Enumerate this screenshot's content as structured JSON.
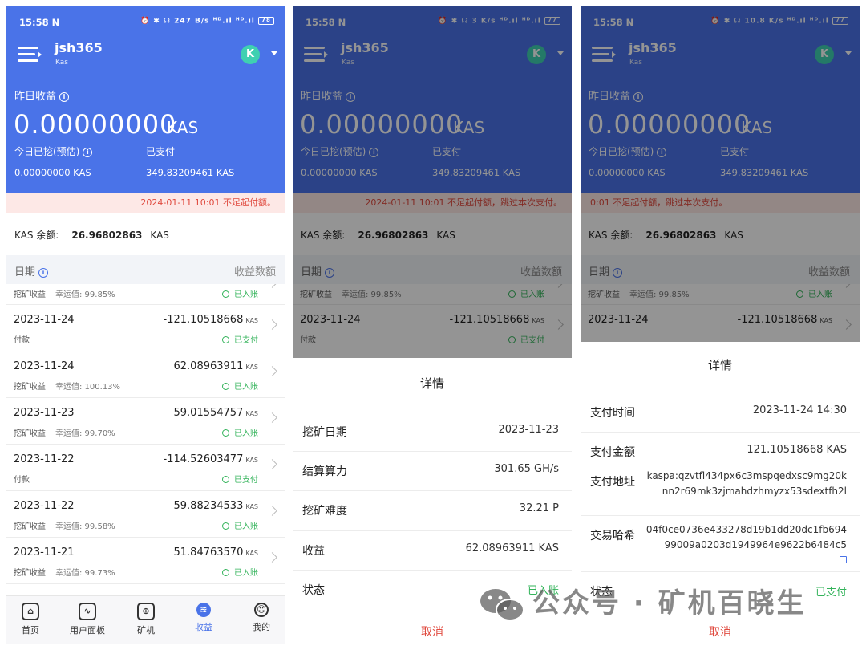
{
  "status": {
    "time": "15:58",
    "icons_left": "N",
    "icons_right_1": "⏰ ✱ ☊ 247 B/s ᴴᴰ.ıl ᴴᴰ.ıl",
    "battery_1": "78",
    "icons_right_2": "⏰ ✱ ☊ 3 K/s ᴴᴰ.ıl ᴴᴰ.ıl",
    "battery_2": "77",
    "icons_right_3": "⏰ ✱ ☊ 10.8 K/s ᴴᴰ.ıl ᴴᴰ.ıl",
    "battery_3": "77"
  },
  "header": {
    "account": "jsh365",
    "coin": "Kas",
    "coin_logo_glyph": "K",
    "yesterday_label": "昨日收益",
    "yesterday_amount": "0.00000000",
    "yesterday_unit": "KAS",
    "today_label": "今日已挖(预估)",
    "paid_label": "已支付",
    "today_value": "0.00000000 KAS",
    "paid_value": "349.83209461 KAS"
  },
  "notice": {
    "p1": "2024-01-11 10:01 不足起付额。",
    "p2": "2024-01-11 10:01 不足起付额，跳过本次支付。",
    "p3": "0:01 不足起付额，跳过本次支付。"
  },
  "balance": {
    "label": "KAS 余额:",
    "value": "26.96802863",
    "unit": "KAS"
  },
  "table": {
    "date_header": "日期",
    "amount_header": "收益数额"
  },
  "rows": [
    {
      "date": "",
      "type": "挖矿收益",
      "luck": "幸运值: 99.85%",
      "amount": "",
      "unit": "",
      "status": "已入账"
    },
    {
      "date": "2023-11-24",
      "type": "付款",
      "luck": "",
      "amount": "-121.10518668",
      "unit": "KAS",
      "status": "已支付"
    },
    {
      "date": "2023-11-24",
      "type": "挖矿收益",
      "luck": "幸运值: 100.13%",
      "amount": "62.08963911",
      "unit": "KAS",
      "status": "已入账"
    },
    {
      "date": "2023-11-23",
      "type": "挖矿收益",
      "luck": "幸运值: 99.70%",
      "amount": "59.01554757",
      "unit": "KAS",
      "status": "已入账"
    },
    {
      "date": "2023-11-22",
      "type": "付款",
      "luck": "",
      "amount": "-114.52603477",
      "unit": "KAS",
      "status": "已支付"
    },
    {
      "date": "2023-11-22",
      "type": "挖矿收益",
      "luck": "幸运值: 99.58%",
      "amount": "59.88234533",
      "unit": "KAS",
      "status": "已入账"
    },
    {
      "date": "2023-11-21",
      "type": "挖矿收益",
      "luck": "幸运值: 99.73%",
      "amount": "51.84763570",
      "unit": "KAS",
      "status": "已入账"
    }
  ],
  "tabs": [
    {
      "label": "首页",
      "icon": "home-icon",
      "glyph": "⌂"
    },
    {
      "label": "用户面板",
      "icon": "chart-icon",
      "glyph": "∿"
    },
    {
      "label": "矿机",
      "icon": "miner-icon",
      "glyph": "⊕"
    },
    {
      "label": "收益",
      "icon": "coins-icon",
      "glyph": "≋"
    },
    {
      "label": "我的",
      "icon": "user-icon",
      "glyph": "☺"
    }
  ],
  "detail_mining": {
    "title": "详情",
    "items": [
      {
        "k": "挖矿日期",
        "v": "2023-11-23"
      },
      {
        "k": "结算算力",
        "v": "301.65 GH/s"
      },
      {
        "k": "挖矿难度",
        "v": "32.21 P"
      },
      {
        "k": "收益",
        "v": "62.08963911 KAS"
      },
      {
        "k": "状态",
        "v": "已入账"
      }
    ],
    "cancel": "取消"
  },
  "detail_payment": {
    "title": "详情",
    "items": [
      {
        "k": "支付时间",
        "v": "2023-11-24 14:30"
      },
      {
        "k": "支付金额",
        "v": "121.10518668 KAS"
      },
      {
        "k": "支付地址",
        "v": "kaspa:qzvtfl434px6c3mspqedxsc9mg20knn2r69mk3zjmahdzhmyzx53sdextfh2l"
      },
      {
        "k": "交易哈希",
        "v": "04f0ce0736e433278d19b1dd20dc1fb69499009a0203d1949964e9622b6484c5"
      },
      {
        "k": "状态",
        "v": "已支付"
      }
    ],
    "cancel": "取消"
  },
  "watermark": "公众号 · 矿机百晓生",
  "colors": {
    "brand": "#4a73e8",
    "accent_green": "#33b35a",
    "warning_red": "#e04a3f",
    "kas_teal": "#3fd0b1"
  }
}
